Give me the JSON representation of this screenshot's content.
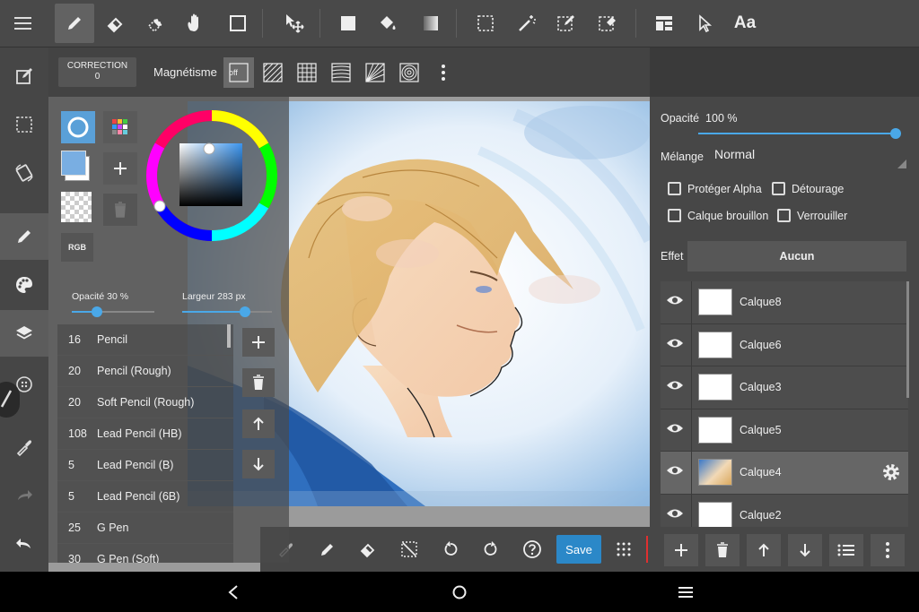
{
  "toolbar": {
    "text_tool_label": "Aa"
  },
  "sub_toolbar": {
    "correction_label": "CORRECTION",
    "correction_value": "0",
    "magnetism_label": "Magnétisme",
    "snap_off_label": "off"
  },
  "brush_panel": {
    "color_mode_label": "RGB",
    "opacity_label": "Opacité",
    "opacity_value": "30",
    "opacity_unit": "%",
    "opacity_fraction": 0.3,
    "width_label": "Largeur",
    "width_value": "283",
    "width_unit": "px",
    "brushes": [
      {
        "size": "16",
        "name": "Pencil"
      },
      {
        "size": "20",
        "name": "Pencil (Rough)"
      },
      {
        "size": "20",
        "name": "Soft Pencil (Rough)"
      },
      {
        "size": "108",
        "name": "Lead Pencil (HB)"
      },
      {
        "size": "5",
        "name": "Lead Pencil (B)"
      },
      {
        "size": "5",
        "name": "Lead Pencil (6B)"
      },
      {
        "size": "25",
        "name": "G Pen"
      },
      {
        "size": "30",
        "name": "G Pen (Soft)"
      }
    ]
  },
  "layer_panel": {
    "opacity_label": "Opacité",
    "opacity_value": "100",
    "opacity_unit": "%",
    "opacity_fraction": 1.0,
    "blend_label": "Mélange",
    "blend_value": "Normal",
    "protect_alpha_label": "Protéger Alpha",
    "clipping_label": "Détourage",
    "draft_layer_label": "Calque brouillon",
    "lock_label": "Verrouiller",
    "effect_label": "Effet",
    "effect_value": "Aucun",
    "layers": [
      {
        "name": "Calque8"
      },
      {
        "name": "Calque6"
      },
      {
        "name": "Calque3"
      },
      {
        "name": "Calque5"
      },
      {
        "name": "Calque4",
        "selected": true
      },
      {
        "name": "Calque2"
      }
    ]
  },
  "canvas_toolbar": {
    "save_label": "Save"
  },
  "colors": {
    "accent": "#4aa8e8",
    "save_button": "#2b88c8",
    "panel_bg": "#474747"
  }
}
